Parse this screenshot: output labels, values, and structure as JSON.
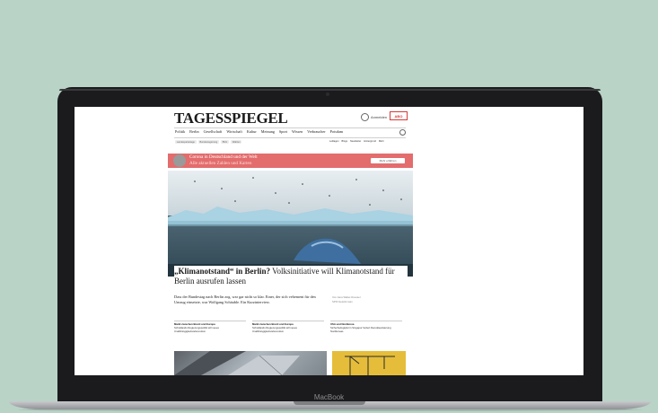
{
  "device": {
    "brand_label": "MacBook"
  },
  "site": {
    "logo": "TAGESSPIEGEL",
    "signin_label": "Anmelden",
    "abo_label": "ABO",
    "nav": [
      "Politik",
      "Berlin",
      "Gesellschaft",
      "Wirtschaft",
      "Kultur",
      "Meinung",
      "Sport",
      "Wissen",
      "Verbraucher",
      "Potsdam"
    ],
    "chips": [
      "Landesparteitage",
      "Bundesregierung",
      "BVG",
      "Wahlen"
    ],
    "sublinks": [
      "Leitlagen",
      "Blogs",
      "Newsletter",
      "Hintergrund",
      "Mehr"
    ],
    "banner": {
      "title": "Corona in Deutschland und der Welt",
      "subtitle": "Alle aktuellen Zahlen und Karten",
      "button_label": "Mehr erfahren"
    },
    "headline_bold": "„Klimanotstand“ in Berlin?",
    "headline_rest": " Volksinitiative will Klimanotstand für Berlin ausrufen lassen",
    "lead": "Dass der Bundestag nach Berlin zog, war gar nicht so klar. Einer, der sich vehement für den Umzug einsetzte, war Wolfgang Schäuble. Ein Kurzinterview.",
    "author": [
      "Von Jana Walter-Roessel",
      "SPD Neuköln kam"
    ],
    "teasers": [
      {
        "title": "Markt zwischen Brexit und Europa",
        "text": "Schottlands Regierungspolitik will neues Unabhängigkeitsreferendum"
      },
      {
        "title": "Markt zwischen Brexit und Europa",
        "text": "Schottlands Regierungspolitik will neues Unabhängigkeitsreferendum"
      },
      {
        "title": "USA und Nordkorea",
        "text": "Sicherheitsgipfel in Singapur fordert Denuklearisierung Nordkoreas"
      }
    ]
  }
}
